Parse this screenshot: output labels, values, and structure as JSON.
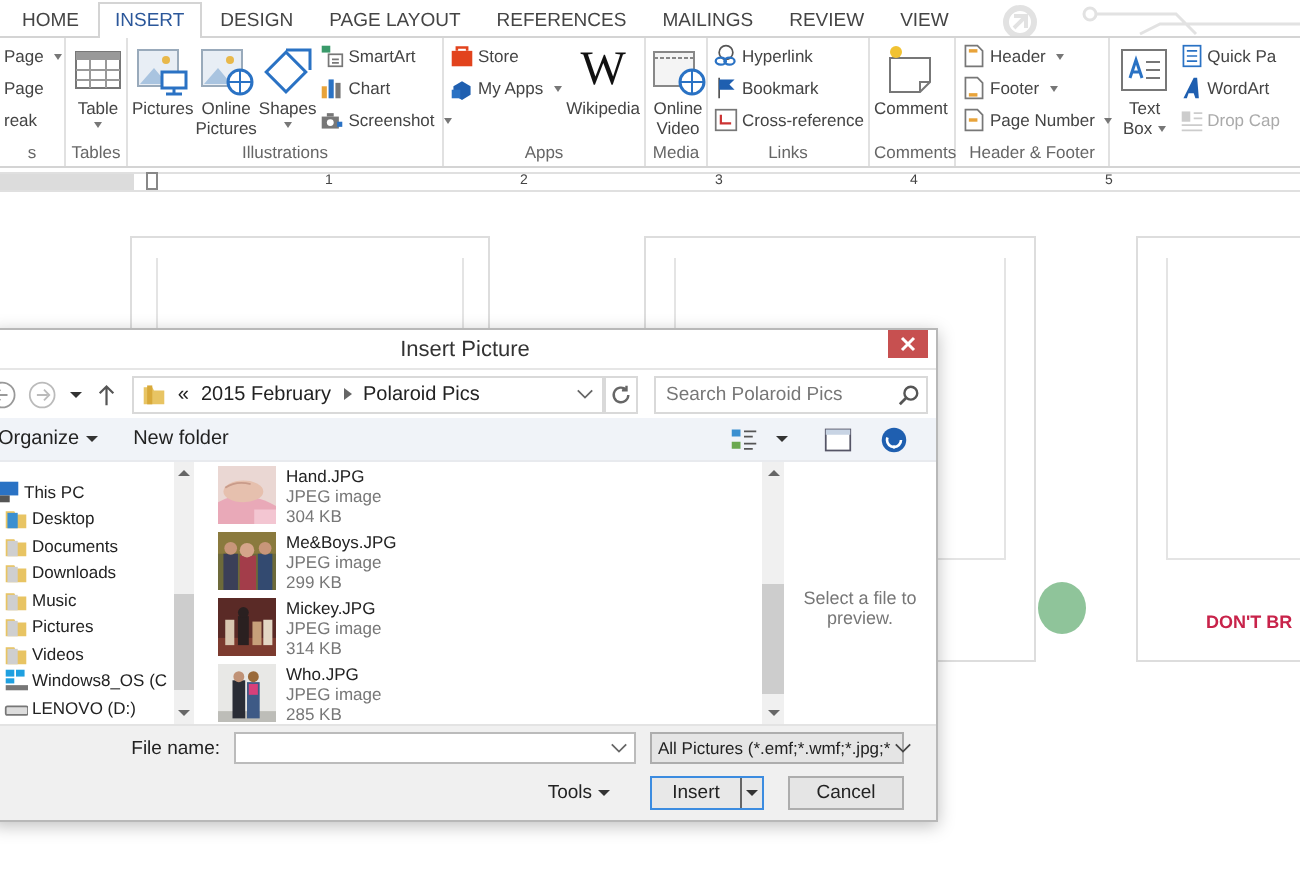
{
  "ribbon_tabs": [
    {
      "label": "HOME",
      "selected": false
    },
    {
      "label": "INSERT",
      "selected": true
    },
    {
      "label": "DESIGN",
      "selected": false
    },
    {
      "label": "PAGE LAYOUT",
      "selected": false
    },
    {
      "label": "REFERENCES",
      "selected": false
    },
    {
      "label": "MAILINGS",
      "selected": false
    },
    {
      "label": "REVIEW",
      "selected": false
    },
    {
      "label": "VIEW",
      "selected": false
    }
  ],
  "ribbon_groups": [
    {
      "label": "s",
      "items": [
        {
          "kind": "small",
          "label": "Page",
          "dropdown": true
        },
        {
          "kind": "small",
          "label": "Page"
        },
        {
          "kind": "small",
          "label": "reak"
        }
      ]
    },
    {
      "label": "Tables",
      "items": [
        {
          "kind": "large",
          "label": "Table",
          "dropdown": true
        }
      ]
    },
    {
      "label": "Illustrations",
      "items": [
        {
          "kind": "large",
          "label": "Pictures"
        },
        {
          "kind": "large",
          "label": "Online Pictures"
        },
        {
          "kind": "large",
          "label": "Shapes",
          "dropdown": true
        },
        {
          "kind": "small",
          "label": "SmartArt"
        },
        {
          "kind": "small",
          "label": "Chart"
        },
        {
          "kind": "small",
          "label": "Screenshot",
          "dropdown": true
        }
      ]
    },
    {
      "label": "Apps",
      "items": [
        {
          "kind": "small",
          "label": "Store"
        },
        {
          "kind": "small",
          "label": "My Apps",
          "dropdown": true
        },
        {
          "kind": "large",
          "label": "Wikipedia",
          "glyph": "W"
        }
      ]
    },
    {
      "label": "Media",
      "items": [
        {
          "kind": "large",
          "label": "Online Video"
        }
      ]
    },
    {
      "label": "Links",
      "items": [
        {
          "kind": "small",
          "label": "Hyperlink"
        },
        {
          "kind": "small",
          "label": "Bookmark"
        },
        {
          "kind": "small",
          "label": "Cross-reference"
        }
      ]
    },
    {
      "label": "Comments",
      "items": [
        {
          "kind": "large",
          "label": "Comment"
        }
      ]
    },
    {
      "label": "Header & Footer",
      "items": [
        {
          "kind": "small",
          "label": "Header",
          "dropdown": true
        },
        {
          "kind": "small",
          "label": "Footer",
          "dropdown": true
        },
        {
          "kind": "small",
          "label": "Page Number",
          "dropdown": true
        }
      ]
    },
    {
      "items": [
        {
          "kind": "large",
          "label": "Text Box",
          "dropdown": true
        },
        {
          "kind": "small",
          "label": "Quick Pa"
        },
        {
          "kind": "small",
          "label": "WordArt"
        },
        {
          "kind": "small",
          "label": "Drop Cap",
          "disabled": true
        }
      ]
    }
  ],
  "ruler": {
    "numbers": [
      "1",
      "2",
      "3",
      "4",
      "5"
    ]
  },
  "document": {
    "page_caption": "DON'T BR"
  },
  "dialog": {
    "title": "Insert Picture",
    "address": {
      "prefix": "«",
      "path": [
        "2015 February",
        "Polaroid Pics"
      ]
    },
    "search": {
      "placeholder": "Search Polaroid Pics"
    },
    "toolbar": {
      "organize": "Organize",
      "new_folder": "New folder"
    },
    "nav_pane": [
      {
        "label": "This PC",
        "children": [
          {
            "label": "Desktop"
          },
          {
            "label": "Documents"
          },
          {
            "label": "Downloads"
          },
          {
            "label": "Music"
          },
          {
            "label": "Pictures"
          },
          {
            "label": "Videos"
          },
          {
            "label": "Windows8_OS (C"
          },
          {
            "label": "LENOVO (D:)"
          }
        ]
      }
    ],
    "files": [
      {
        "name": "Hand.JPG",
        "type": "JPEG image",
        "size": "304 KB"
      },
      {
        "name": "Me&Boys.JPG",
        "type": "JPEG image",
        "size": "299 KB"
      },
      {
        "name": "Mickey.JPG",
        "type": "JPEG image",
        "size": "314 KB"
      },
      {
        "name": "Who.JPG",
        "type": "JPEG image",
        "size": "285 KB"
      }
    ],
    "preview_text": "Select a file to preview.",
    "file_name_label": "File name:",
    "file_type": "All Pictures (*.emf;*.wmf;*.jpg;*",
    "tools": "Tools",
    "insert": "Insert",
    "cancel": "Cancel"
  }
}
